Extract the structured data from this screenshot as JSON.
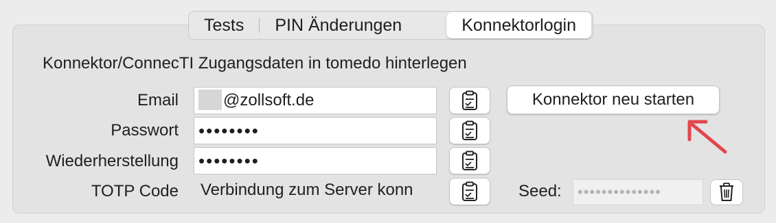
{
  "tabs": [
    {
      "label": "Tests",
      "active": false
    },
    {
      "label": "PIN Änderungen",
      "active": false
    },
    {
      "label": "Konnektorlogin",
      "active": true
    }
  ],
  "heading": "Konnektor/ConnecTI Zugangsdaten in tomedo hinterlegen",
  "form": {
    "email": {
      "label": "Email",
      "value": "@zollsoft.de"
    },
    "password": {
      "label": "Passwort",
      "value": "••••••••"
    },
    "recovery": {
      "label": "Wiederherstellung",
      "value": "••••••••"
    },
    "totp": {
      "label": "TOTP Code",
      "value": "Verbindung zum Server konn"
    }
  },
  "restart_button": "Konnektor neu starten",
  "seed": {
    "label": "Seed:",
    "value": "••••••••••••••"
  },
  "icons": {
    "copy": "clipboard-icon",
    "delete": "trash-icon"
  },
  "colors": {
    "annotation_arrow": "#e0474c"
  }
}
